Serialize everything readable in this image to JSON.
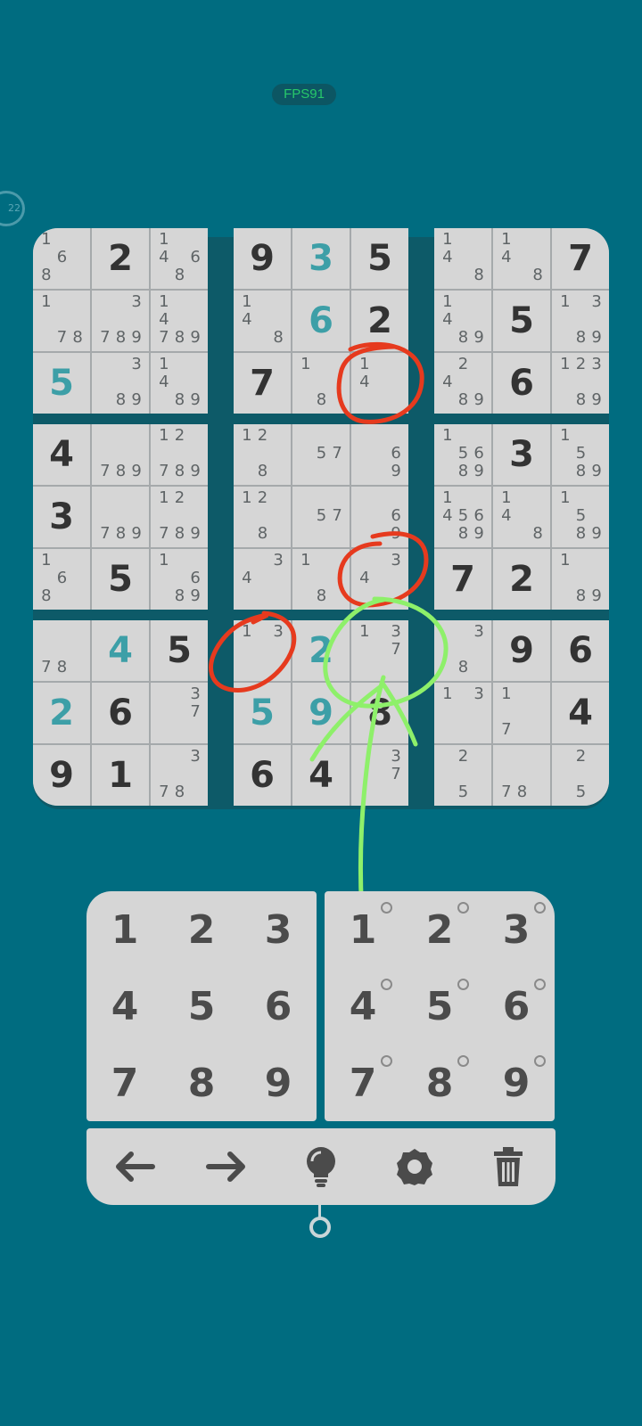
{
  "status": {
    "fps_label": "FPS91",
    "timer_label": "22"
  },
  "board": {
    "rows": [
      [
        {
          "n": "1   6 8  "
        },
        {
          "v": "2",
          "t": "given"
        },
        {
          "n": "1  4 6 8 "
        },
        {
          "v": "9",
          "t": "given"
        },
        {
          "v": "3",
          "t": "user"
        },
        {
          "v": "5",
          "t": "given"
        },
        {
          "n": "1  4    8 "
        },
        {
          "n": "1  4    8 "
        },
        {
          "v": "7",
          "t": "given"
        }
      ],
      [
        {
          "n": "1      78"
        },
        {
          "n": "  3   789"
        },
        {
          "n": "1  4  789"
        },
        {
          "n": "1  4    8 "
        },
        {
          "v": "6",
          "t": "user"
        },
        {
          "v": "2",
          "t": "given"
        },
        {
          "n": "1  4   89"
        },
        {
          "v": "5",
          "t": "given"
        },
        {
          "n": "1 3    89"
        }
      ],
      [
        {
          "v": "5",
          "t": "user"
        },
        {
          "n": "  3    89"
        },
        {
          "n": "1  4   89"
        },
        {
          "v": "7",
          "t": "given"
        },
        {
          "n": "1      8 "
        },
        {
          "n": "1  4     "
        },
        {
          "n": " 2 4   89"
        },
        {
          "v": "6",
          "t": "given"
        },
        {
          "n": "123    89"
        }
      ],
      [
        {
          "v": "4",
          "t": "given"
        },
        {
          "n": "      789"
        },
        {
          "n": "12    789"
        },
        {
          "n": "12     8 "
        },
        {
          "n": "    57   "
        },
        {
          "n": "     6  9"
        },
        {
          "n": "1   56 89"
        },
        {
          "v": "3",
          "t": "given"
        },
        {
          "n": "1   5  89"
        }
      ],
      [
        {
          "v": "3",
          "t": "given"
        },
        {
          "n": "      789"
        },
        {
          "n": "12    789"
        },
        {
          "n": "12     8 "
        },
        {
          "n": "    57   "
        },
        {
          "n": "     6  9"
        },
        {
          "n": "1  456 89"
        },
        {
          "n": "1  4    8 "
        },
        {
          "n": "1   5  89"
        }
      ],
      [
        {
          "n": "1   6 8  "
        },
        {
          "v": "5",
          "t": "given"
        },
        {
          "n": "1    6 89"
        },
        {
          "n": "  34     "
        },
        {
          "n": "1      8 "
        },
        {
          "n": "  34     "
        },
        {
          "v": "7",
          "t": "given"
        },
        {
          "v": "2",
          "t": "given"
        },
        {
          "n": "1      89"
        }
      ],
      [
        {
          "n": "      78 "
        },
        {
          "v": "4",
          "t": "user"
        },
        {
          "v": "5",
          "t": "given"
        },
        {
          "n": "1 3      "
        },
        {
          "v": "2",
          "t": "user"
        },
        {
          "n": "1 3  7   "
        },
        {
          "n": "  3    8 "
        },
        {
          "v": "9",
          "t": "given"
        },
        {
          "v": "6",
          "t": "given"
        }
      ],
      [
        {
          "v": "2",
          "t": "user"
        },
        {
          "v": "6",
          "t": "given"
        },
        {
          "n": "  3  7   "
        },
        {
          "v": "5",
          "t": "user"
        },
        {
          "v": "9",
          "t": "user"
        },
        {
          "v": "8",
          "t": "given"
        },
        {
          "n": "1 3      "
        },
        {
          "n": "1     7  "
        },
        {
          "v": "4",
          "t": "given"
        }
      ],
      [
        {
          "v": "9",
          "t": "given"
        },
        {
          "v": "1",
          "t": "given"
        },
        {
          "n": "  3   78 "
        },
        {
          "v": "6",
          "t": "given"
        },
        {
          "v": "4",
          "t": "given"
        },
        {
          "n": "  3  7   "
        },
        {
          "n": " 2     5 "
        },
        {
          "n": "      78 "
        },
        {
          "n": " 2     5 "
        }
      ]
    ]
  },
  "keypad": {
    "digits": [
      "1",
      "2",
      "3",
      "4",
      "5",
      "6",
      "7",
      "8",
      "9"
    ],
    "notes": [
      "1",
      "2",
      "3",
      "4",
      "5",
      "6",
      "7",
      "8",
      "9"
    ]
  },
  "toolbar": {
    "tools": [
      {
        "icon": "arrow-left-icon"
      },
      {
        "icon": "arrow-right-icon"
      },
      {
        "icon": "lightbulb-icon"
      },
      {
        "icon": "gear-icon"
      },
      {
        "icon": "trash-icon"
      }
    ]
  },
  "colors": {
    "background": "#006c80",
    "cell": "#d6d6d6",
    "given_digit": "#333333",
    "user_digit": "#3d9fa7",
    "annotation_red": "#e63a1e",
    "annotation_green": "#8ef06a"
  }
}
